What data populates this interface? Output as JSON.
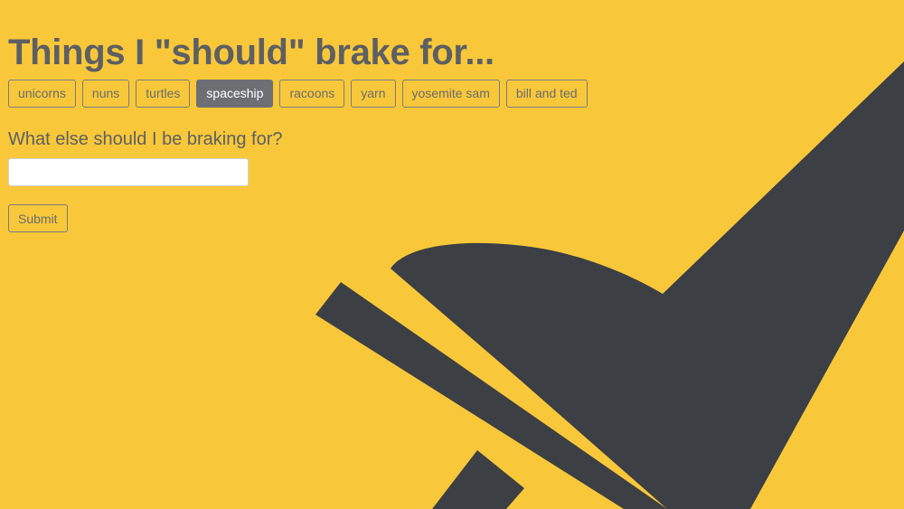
{
  "page": {
    "title": "Things I \"should\" brake for...",
    "background_color": "#F8C83A",
    "accent_color": "#6C7075",
    "art_color": "#3C3F44"
  },
  "chips": [
    {
      "label": "unicorns",
      "selected": false
    },
    {
      "label": "nuns",
      "selected": false
    },
    {
      "label": "turtles",
      "selected": false
    },
    {
      "label": "spaceship",
      "selected": true
    },
    {
      "label": "racoons",
      "selected": false
    },
    {
      "label": "yarn",
      "selected": false
    },
    {
      "label": "yosemite sam",
      "selected": false
    },
    {
      "label": "bill and ted",
      "selected": false
    }
  ],
  "form": {
    "prompt": "What else should I be braking for?",
    "input_value": "",
    "input_placeholder": "",
    "submit_label": "Submit"
  },
  "background_art": {
    "icon": "spaceship-silhouette-icon"
  }
}
